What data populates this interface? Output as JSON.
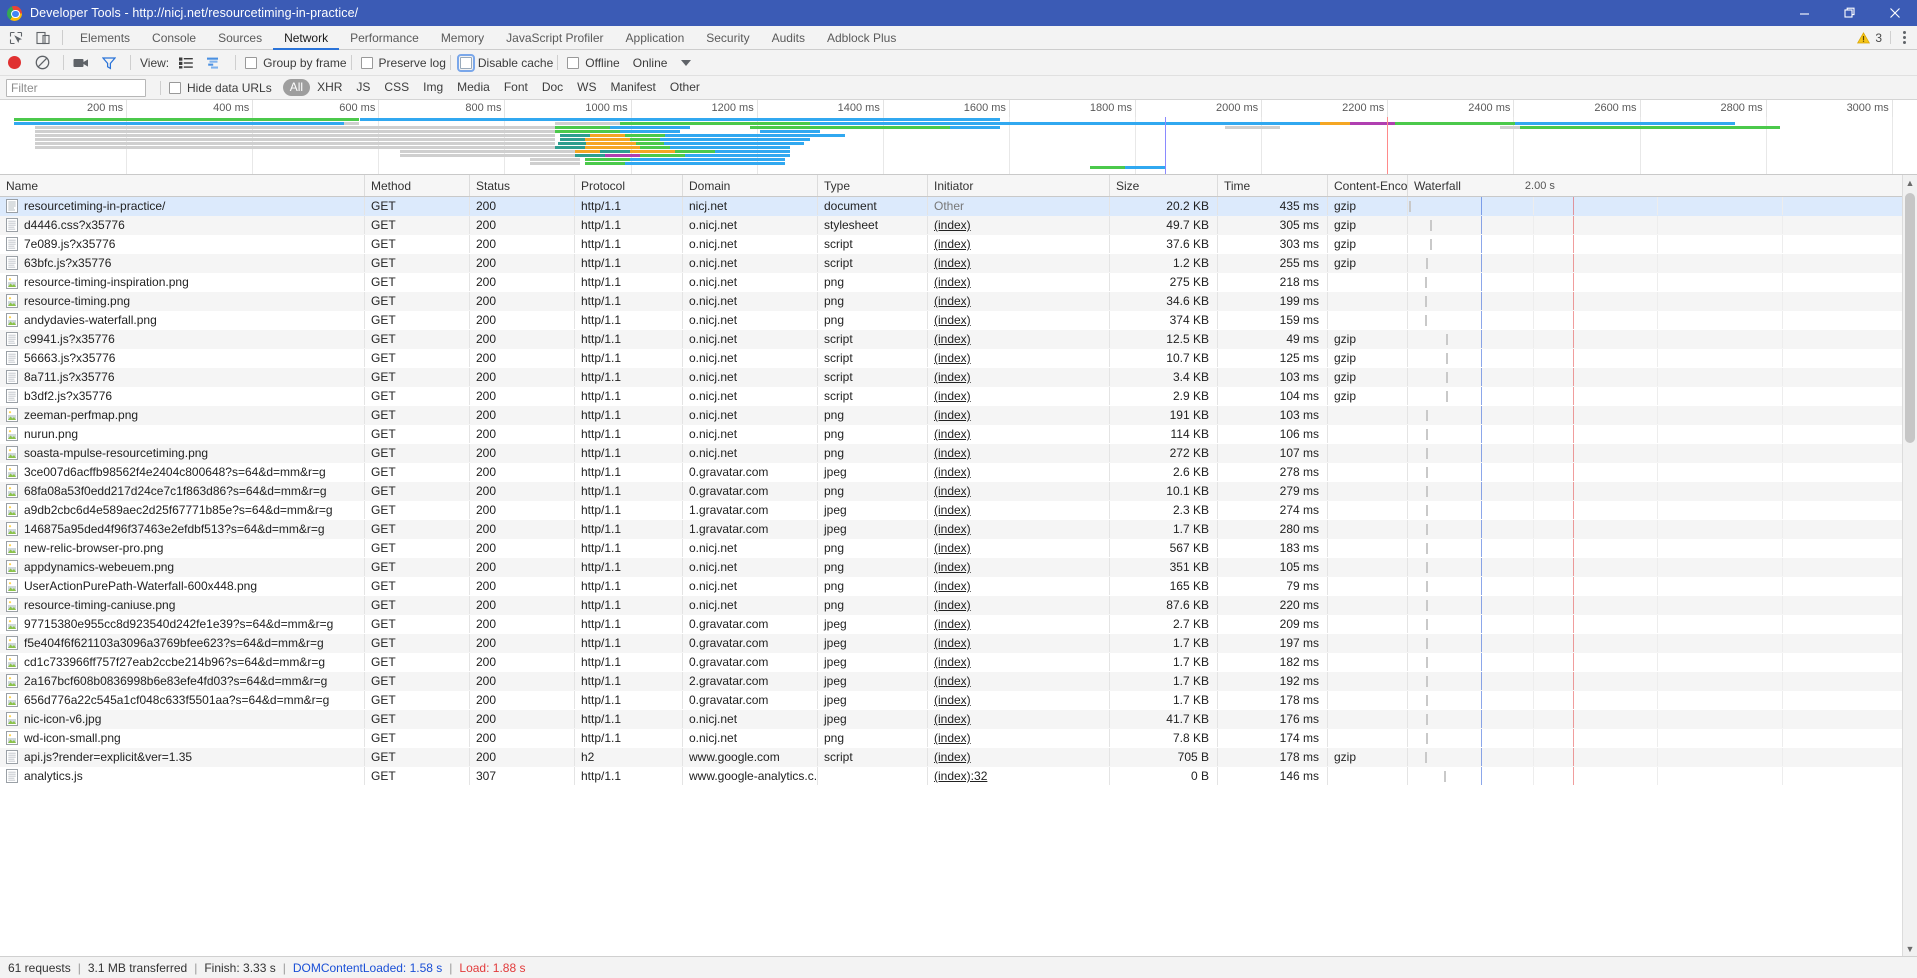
{
  "window": {
    "title": "Developer Tools - http://nicj.net/resourcetiming-in-practice/",
    "minimize_label": "Minimize",
    "maximize_label": "Restore",
    "close_label": "Close"
  },
  "tabstrip": {
    "inspect_icon": "inspect-element-icon",
    "device_icon": "device-toolbar-icon",
    "tabs": [
      {
        "label": "Elements",
        "active": false
      },
      {
        "label": "Console",
        "active": false
      },
      {
        "label": "Sources",
        "active": false
      },
      {
        "label": "Network",
        "active": true
      },
      {
        "label": "Performance",
        "active": false
      },
      {
        "label": "Memory",
        "active": false
      },
      {
        "label": "JavaScript Profiler",
        "active": false
      },
      {
        "label": "Application",
        "active": false
      },
      {
        "label": "Security",
        "active": false
      },
      {
        "label": "Audits",
        "active": false
      },
      {
        "label": "Adblock Plus",
        "active": false
      }
    ],
    "warning_count": "3",
    "warning_icon": "warning-triangle-icon",
    "menu_icon": "more-vertical-icon"
  },
  "toolbar": {
    "record_label": "Record",
    "clear_label": "Clear",
    "capture_screenshots_label": "Capture screenshots",
    "filter_toggle_label": "Filter",
    "view_label": "View:",
    "view_list_icon": "list-view-icon",
    "view_waterfall_icon": "waterfall-view-icon",
    "group_by_frame": {
      "label": "Group by frame",
      "checked": false
    },
    "preserve_log": {
      "label": "Preserve log",
      "checked": false
    },
    "disable_cache": {
      "label": "Disable cache",
      "checked": false,
      "focused": true
    },
    "offline": {
      "label": "Offline",
      "checked": false
    },
    "throttling_value": "Online",
    "throttling_caret_icon": "chevron-down-icon"
  },
  "filterbar": {
    "filter_placeholder": "Filter",
    "filter_value": "",
    "hide_data_urls": {
      "label": "Hide data URLs",
      "checked": false
    },
    "types": [
      {
        "label": "All",
        "selected": true
      },
      {
        "label": "XHR",
        "selected": false
      },
      {
        "label": "JS",
        "selected": false
      },
      {
        "label": "CSS",
        "selected": false
      },
      {
        "label": "Img",
        "selected": false
      },
      {
        "label": "Media",
        "selected": false
      },
      {
        "label": "Font",
        "selected": false
      },
      {
        "label": "Doc",
        "selected": false
      },
      {
        "label": "WS",
        "selected": false
      },
      {
        "label": "Manifest",
        "selected": false
      },
      {
        "label": "Other",
        "selected": false
      }
    ]
  },
  "overview": {
    "ticks": [
      "200 ms",
      "400 ms",
      "600 ms",
      "800 ms",
      "1000 ms",
      "1200 ms",
      "1400 ms",
      "1600 ms",
      "1800 ms",
      "2000 ms",
      "2200 ms",
      "2400 ms",
      "2600 ms",
      "2800 ms",
      "3000 ms"
    ],
    "dcl_marker_color": "#8a8aff",
    "load_marker_color": "#ff8a8a"
  },
  "table": {
    "columns": [
      "Name",
      "Method",
      "Status",
      "Protocol",
      "Domain",
      "Type",
      "Initiator",
      "Size",
      "Time",
      "Content-Enco...",
      "Waterfall"
    ],
    "waterfall_scale": "2.00 s",
    "sort_arrow_icon": "sort-ascending-icon",
    "rows": [
      {
        "icon": "document-icon",
        "name": "resourcetiming-in-practice/",
        "method": "GET",
        "status": "200",
        "protocol": "http/1.1",
        "domain": "nicj.net",
        "type": "document",
        "initiator": "Other",
        "initiator_link": false,
        "size": "20.2 KB",
        "time": "435 ms",
        "encoding": "gzip",
        "bar": {
          "start": 0.2,
          "stall": 0.4,
          "ttfb": 1.2,
          "dl": 0.6
        },
        "selected": true
      },
      {
        "icon": "stylesheet-icon",
        "name": "d4446.css?x35776",
        "method": "GET",
        "status": "200",
        "protocol": "http/1.1",
        "domain": "o.nicj.net",
        "type": "stylesheet",
        "initiator": "(index)",
        "initiator_link": true,
        "size": "49.7 KB",
        "time": "305 ms",
        "encoding": "gzip",
        "bar": {
          "start": 4.3,
          "stall": 0.3,
          "ttfb": 0.8,
          "dl": 4.6
        }
      },
      {
        "icon": "script-icon",
        "name": "7e089.js?x35776",
        "method": "GET",
        "status": "200",
        "protocol": "http/1.1",
        "domain": "o.nicj.net",
        "type": "script",
        "initiator": "(index)",
        "initiator_link": true,
        "size": "37.6 KB",
        "time": "303 ms",
        "encoding": "gzip",
        "bar": {
          "start": 4.3,
          "stall": 0.3,
          "ttfb": 0.8,
          "dl": 4.6
        }
      },
      {
        "icon": "script-icon",
        "name": "63bfc.js?x35776",
        "method": "GET",
        "status": "200",
        "protocol": "http/1.1",
        "domain": "o.nicj.net",
        "type": "script",
        "initiator": "(index)",
        "initiator_link": true,
        "size": "1.2 KB",
        "time": "255 ms",
        "encoding": "gzip",
        "bar": {
          "start": 3.6,
          "stall": 1.0,
          "ttfb": 0.5,
          "dl": 4.6
        }
      },
      {
        "icon": "image-icon",
        "name": "resource-timing-inspiration.png",
        "method": "GET",
        "status": "200",
        "protocol": "http/1.1",
        "domain": "o.nicj.net",
        "type": "png",
        "initiator": "(index)",
        "initiator_link": true,
        "size": "275 KB",
        "time": "218 ms",
        "encoding": "",
        "bar": {
          "start": 3.4,
          "stall": 1.4,
          "ttfb": 0.5,
          "dl": 4.4
        }
      },
      {
        "icon": "image-icon",
        "name": "resource-timing.png",
        "method": "GET",
        "status": "200",
        "protocol": "http/1.1",
        "domain": "o.nicj.net",
        "type": "png",
        "initiator": "(index)",
        "initiator_link": true,
        "size": "34.6 KB",
        "time": "199 ms",
        "encoding": "",
        "bar": {
          "start": 3.4,
          "stall": 3.2,
          "ttfb": 0.5,
          "dl": 4.4
        }
      },
      {
        "icon": "image-icon",
        "name": "andydavies-waterfall.png",
        "method": "GET",
        "status": "200",
        "protocol": "http/1.1",
        "domain": "o.nicj.net",
        "type": "png",
        "initiator": "(index)",
        "initiator_link": true,
        "size": "374 KB",
        "time": "159 ms",
        "encoding": "",
        "bar": {
          "start": 3.4,
          "stall": 3.4,
          "ttfb": 0.5,
          "dl": 4.2
        }
      },
      {
        "icon": "script-icon",
        "name": "c9941.js?x35776",
        "method": "GET",
        "status": "200",
        "protocol": "http/1.1",
        "domain": "o.nicj.net",
        "type": "script",
        "initiator": "(index)",
        "initiator_link": true,
        "size": "12.5 KB",
        "time": "49 ms",
        "encoding": "gzip",
        "bar": {
          "start": 7.5,
          "stall": 0.4,
          "ttfb": 0.7,
          "dl": 0.3
        }
      },
      {
        "icon": "script-icon",
        "name": "56663.js?x35776",
        "method": "GET",
        "status": "200",
        "protocol": "http/1.1",
        "domain": "o.nicj.net",
        "type": "script",
        "initiator": "(index)",
        "initiator_link": true,
        "size": "10.7 KB",
        "time": "125 ms",
        "encoding": "gzip",
        "bar": {
          "start": 7.4,
          "stall": 0.5,
          "ttfb": 0.6,
          "dl": 2.3
        }
      },
      {
        "icon": "script-icon",
        "name": "8a711.js?x35776",
        "method": "GET",
        "status": "200",
        "protocol": "http/1.1",
        "domain": "o.nicj.net",
        "type": "script",
        "initiator": "(index)",
        "initiator_link": true,
        "size": "3.4 KB",
        "time": "103 ms",
        "encoding": "gzip",
        "bar": {
          "start": 7.5,
          "stall": 0.4,
          "ttfb": 0.6,
          "dl": 2.0
        }
      },
      {
        "icon": "script-icon",
        "name": "b3df2.js?x35776",
        "method": "GET",
        "status": "200",
        "protocol": "http/1.1",
        "domain": "o.nicj.net",
        "type": "script",
        "initiator": "(index)",
        "initiator_link": true,
        "size": "2.9 KB",
        "time": "104 ms",
        "encoding": "gzip",
        "bar": {
          "start": 7.5,
          "stall": 0.4,
          "ttfb": 0.6,
          "dl": 2.0
        }
      },
      {
        "icon": "image-icon",
        "name": "zeeman-perfmap.png",
        "method": "GET",
        "status": "200",
        "protocol": "http/1.1",
        "domain": "o.nicj.net",
        "type": "png",
        "initiator": "(index)",
        "initiator_link": true,
        "size": "191 KB",
        "time": "103 ms",
        "encoding": "",
        "bar": {
          "start": 3.5,
          "stall": 4.2,
          "ttfb": 0.4,
          "dl": 1.8
        }
      },
      {
        "icon": "image-icon",
        "name": "nurun.png",
        "method": "GET",
        "status": "200",
        "protocol": "http/1.1",
        "domain": "o.nicj.net",
        "type": "png",
        "initiator": "(index)",
        "initiator_link": true,
        "size": "114 KB",
        "time": "106 ms",
        "encoding": "",
        "bar": {
          "start": 3.5,
          "stall": 4.2,
          "ttfb": 0.4,
          "dl": 1.9
        }
      },
      {
        "icon": "image-icon",
        "name": "soasta-mpulse-resourcetiming.png",
        "method": "GET",
        "status": "200",
        "protocol": "http/1.1",
        "domain": "o.nicj.net",
        "type": "png",
        "initiator": "(index)",
        "initiator_link": true,
        "size": "272 KB",
        "time": "107 ms",
        "encoding": "",
        "bar": {
          "start": 3.5,
          "stall": 4.2,
          "ttfb": 0.4,
          "dl": 1.9
        }
      },
      {
        "icon": "image-icon",
        "name": "3ce007d6acffb98562f4e2404c800648?s=64&d=mm&r=g",
        "method": "GET",
        "status": "200",
        "protocol": "http/1.1",
        "domain": "0.gravatar.com",
        "type": "jpeg",
        "initiator": "(index)",
        "initiator_link": true,
        "size": "2.6 KB",
        "time": "278 ms",
        "encoding": "",
        "bar": {
          "start": 3.5,
          "stall": 4.0,
          "ttfb": 1.3,
          "dl": 1.4
        }
      },
      {
        "icon": "image-icon",
        "name": "68fa08a53f0edd217d24ce7c1f863d86?s=64&d=mm&r=g",
        "method": "GET",
        "status": "200",
        "protocol": "http/1.1",
        "domain": "0.gravatar.com",
        "type": "png",
        "initiator": "(index)",
        "initiator_link": true,
        "size": "10.1 KB",
        "time": "279 ms",
        "encoding": "",
        "bar": {
          "start": 3.5,
          "stall": 4.0,
          "ttfb": 1.3,
          "dl": 1.4
        }
      },
      {
        "icon": "image-icon",
        "name": "a9db2cbc6d4e589aec2d25f67771b85e?s=64&d=mm&r=g",
        "method": "GET",
        "status": "200",
        "protocol": "http/1.1",
        "domain": "1.gravatar.com",
        "type": "jpeg",
        "initiator": "(index)",
        "initiator_link": true,
        "size": "2.3 KB",
        "time": "274 ms",
        "encoding": "",
        "bar": {
          "start": 3.5,
          "stall": 4.0,
          "ttfb": 1.3,
          "dl": 1.3
        }
      },
      {
        "icon": "image-icon",
        "name": "146875a95ded4f96f37463e2efdbf513?s=64&d=mm&r=g",
        "method": "GET",
        "status": "200",
        "protocol": "http/1.1",
        "domain": "1.gravatar.com",
        "type": "jpeg",
        "initiator": "(index)",
        "initiator_link": true,
        "size": "1.7 KB",
        "time": "280 ms",
        "encoding": "",
        "bar": {
          "start": 3.5,
          "stall": 4.1,
          "ttfb": 1.3,
          "dl": 1.3
        }
      },
      {
        "icon": "image-icon",
        "name": "new-relic-browser-pro.png",
        "method": "GET",
        "status": "200",
        "protocol": "http/1.1",
        "domain": "o.nicj.net",
        "type": "png",
        "initiator": "(index)",
        "initiator_link": true,
        "size": "567 KB",
        "time": "183 ms",
        "encoding": "",
        "bar": {
          "start": 3.5,
          "stall": 5.0,
          "ttfb": 0.4,
          "dl": 1.7
        }
      },
      {
        "icon": "image-icon",
        "name": "appdynamics-webeuem.png",
        "method": "GET",
        "status": "200",
        "protocol": "http/1.1",
        "domain": "o.nicj.net",
        "type": "png",
        "initiator": "(index)",
        "initiator_link": true,
        "size": "351 KB",
        "time": "105 ms",
        "encoding": "",
        "bar": {
          "start": 3.5,
          "stall": 5.1,
          "ttfb": 0.4,
          "dl": 1.5
        }
      },
      {
        "icon": "image-icon",
        "name": "UserActionPurePath-Waterfall-600x448.png",
        "method": "GET",
        "status": "200",
        "protocol": "http/1.1",
        "domain": "o.nicj.net",
        "type": "png",
        "initiator": "(index)",
        "initiator_link": true,
        "size": "165 KB",
        "time": "79 ms",
        "encoding": "",
        "bar": {
          "start": 3.5,
          "stall": 5.3,
          "ttfb": 0.4,
          "dl": 1.1
        }
      },
      {
        "icon": "image-icon",
        "name": "resource-timing-caniuse.png",
        "method": "GET",
        "status": "200",
        "protocol": "http/1.1",
        "domain": "o.nicj.net",
        "type": "png",
        "initiator": "(index)",
        "initiator_link": true,
        "size": "87.6 KB",
        "time": "220 ms",
        "encoding": "",
        "bar": {
          "start": 3.5,
          "stall": 5.0,
          "ttfb": 0.4,
          "dl": 2.1
        }
      },
      {
        "icon": "image-icon",
        "name": "97715380e955cc8d923540d242fe1e39?s=64&d=mm&r=g",
        "method": "GET",
        "status": "200",
        "protocol": "http/1.1",
        "domain": "0.gravatar.com",
        "type": "jpeg",
        "initiator": "(index)",
        "initiator_link": true,
        "size": "2.7 KB",
        "time": "209 ms",
        "encoding": "",
        "bar": {
          "start": 3.5,
          "stall": 5.0,
          "ttfb": 1.1,
          "dl": 1.3
        }
      },
      {
        "icon": "image-icon",
        "name": "f5e404f6f621103a3096a3769bfee623?s=64&d=mm&r=g",
        "method": "GET",
        "status": "200",
        "protocol": "http/1.1",
        "domain": "0.gravatar.com",
        "type": "jpeg",
        "initiator": "(index)",
        "initiator_link": true,
        "size": "1.7 KB",
        "time": "197 ms",
        "encoding": "",
        "bar": {
          "start": 3.5,
          "stall": 5.0,
          "ttfb": 1.1,
          "dl": 1.2
        }
      },
      {
        "icon": "image-icon",
        "name": "cd1c733966ff757f27eab2ccbe214b96?s=64&d=mm&r=g",
        "method": "GET",
        "status": "200",
        "protocol": "http/1.1",
        "domain": "0.gravatar.com",
        "type": "jpeg",
        "initiator": "(index)",
        "initiator_link": true,
        "size": "1.7 KB",
        "time": "182 ms",
        "encoding": "",
        "bar": {
          "start": 3.5,
          "stall": 5.1,
          "ttfb": 1.0,
          "dl": 1.2
        }
      },
      {
        "icon": "image-icon",
        "name": "2a167bcf608b0836998b6e83efe4fd03?s=64&d=mm&r=g",
        "method": "GET",
        "status": "200",
        "protocol": "http/1.1",
        "domain": "2.gravatar.com",
        "type": "jpeg",
        "initiator": "(index)",
        "initiator_link": true,
        "size": "1.7 KB",
        "time": "192 ms",
        "encoding": "",
        "bar": {
          "start": 3.5,
          "stall": 5.1,
          "ttfb": 1.0,
          "dl": 1.2
        }
      },
      {
        "icon": "image-icon",
        "name": "656d776a22c545a1cf048c633f5501aa?s=64&d=mm&r=g",
        "method": "GET",
        "status": "200",
        "protocol": "http/1.1",
        "domain": "0.gravatar.com",
        "type": "jpeg",
        "initiator": "(index)",
        "initiator_link": true,
        "size": "1.7 KB",
        "time": "178 ms",
        "encoding": "",
        "bar": {
          "start": 3.5,
          "stall": 5.1,
          "ttfb": 1.0,
          "dl": 1.2
        }
      },
      {
        "icon": "image-icon",
        "name": "nic-icon-v6.jpg",
        "method": "GET",
        "status": "200",
        "protocol": "http/1.1",
        "domain": "o.nicj.net",
        "type": "jpeg",
        "initiator": "(index)",
        "initiator_link": true,
        "size": "41.7 KB",
        "time": "176 ms",
        "encoding": "",
        "bar": {
          "start": 3.5,
          "stall": 5.5,
          "ttfb": 0.4,
          "dl": 1.3
        }
      },
      {
        "icon": "image-icon",
        "name": "wd-icon-small.png",
        "method": "GET",
        "status": "200",
        "protocol": "http/1.1",
        "domain": "o.nicj.net",
        "type": "png",
        "initiator": "(index)",
        "initiator_link": true,
        "size": "7.8 KB",
        "time": "174 ms",
        "encoding": "",
        "bar": {
          "start": 3.5,
          "stall": 5.5,
          "ttfb": 0.4,
          "dl": 1.3
        }
      },
      {
        "icon": "script-icon",
        "name": "api.js?render=explicit&ver=1.35",
        "method": "GET",
        "status": "200",
        "protocol": "h2",
        "domain": "www.google.com",
        "type": "script",
        "initiator": "(index)",
        "initiator_link": true,
        "size": "705 B",
        "time": "178 ms",
        "encoding": "gzip",
        "bar": {
          "start": 3.4,
          "stall": 5.4,
          "ttfb": 1.3,
          "dl": 0.5
        }
      },
      {
        "icon": "script-icon",
        "name": "analytics.js",
        "method": "GET",
        "status": "307",
        "protocol": "http/1.1",
        "domain": "www.google-analytics.c...",
        "type": "",
        "initiator": "(index):32",
        "initiator_link": true,
        "size": "0 B",
        "time": "146 ms",
        "encoding": "",
        "bar": {
          "start": 7.0,
          "stall": 1.0,
          "ttfb": 0.6,
          "dl": 1.6
        }
      }
    ]
  },
  "statusbar": {
    "requests": "61 requests",
    "transferred": "3.1 MB transferred",
    "finish": "Finish: 3.33 s",
    "dom_content_loaded": "DOMContentLoaded: 1.58 s",
    "load": "Load: 1.88 s",
    "separator": "|"
  },
  "colors": {
    "accent": "#2a73d8",
    "titlebar": "#3b5bb5",
    "record": "#e03131",
    "ttfb": "#4bc94b",
    "download": "#31a8f0",
    "dcl": "#1a4fd6",
    "load": "#e23b3b"
  }
}
